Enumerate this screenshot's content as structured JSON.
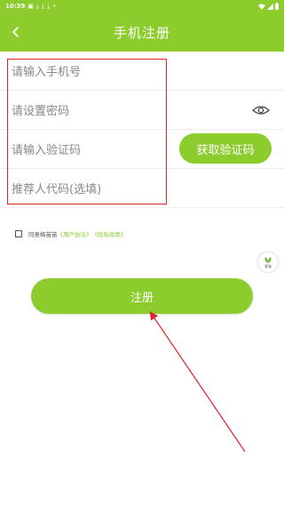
{
  "status_bar": {
    "time": "10:39",
    "left_icons": [
      "image-icon",
      "download-icon",
      "download-icon",
      "download-icon",
      "dot-icon"
    ],
    "right_icons": [
      "wifi-icon",
      "signal-icon",
      "battery-icon"
    ]
  },
  "header": {
    "title": "手机注册",
    "back_icon": "chevron-left-icon"
  },
  "form": {
    "phone_placeholder": "请输入手机号",
    "password_placeholder": "请设置密码",
    "code_placeholder": "请输入验证码",
    "referrer_placeholder": "推荐人代码(选填)",
    "get_code_label": "获取验证码",
    "password_visibility_icon": "eye-icon"
  },
  "agreement": {
    "prefix": "同意梅苗苗",
    "user_agreement": "《用户协议》",
    "privacy_policy": "《隐私政策》"
  },
  "float_widget": {
    "label": "客服",
    "icon": "leaf-icon"
  },
  "register_label": "注册",
  "colors": {
    "brand_green": "#8ccc2c",
    "annotation_red": "#e0222a"
  }
}
